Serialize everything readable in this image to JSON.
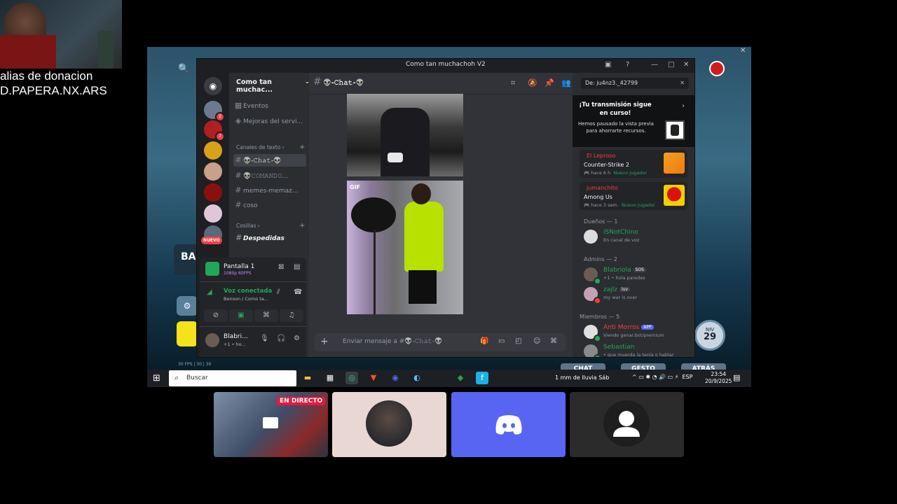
{
  "overlay": {
    "alias_line1": "alias de donacion",
    "alias_line2": "D.PAPERA.NX.ARS"
  },
  "desktop": {
    "ba_label": "BA",
    "niv_label": "NIV",
    "niv_value": "29",
    "fps_text": "30 FPS | 30 | 30",
    "buttons": [
      "CHAT",
      "GESTO",
      "ATRÁS"
    ]
  },
  "window": {
    "title": "Como tan muchachoh V2"
  },
  "servers": {
    "nuevo_label": "NUEVO",
    "badges": [
      "2",
      "2"
    ]
  },
  "channels": {
    "server_name": "Como tan muchac...",
    "top_items": [
      "Eventos",
      "Mejoras del servi..."
    ],
    "category_text": "Canales de texto",
    "items": [
      "👽-𝙲𝚑𝚊𝚝-👽",
      "👽𝙲𝙾𝙼𝙰𝙽𝙳𝙾...",
      "memes-memaz...",
      "coso"
    ],
    "category_cosillas": "Cosillas",
    "despedidas": "Despedidas"
  },
  "voice": {
    "screen_name": "Pantalla 1",
    "screen_quality": "1080p 60FPS",
    "status": "Voz conectada",
    "location": "Benson / Como ta...",
    "user_name": "Blabri...",
    "user_status": "+1 • ho..."
  },
  "chat": {
    "channel_name": "👽-𝙲𝚑𝚊𝚝-👽",
    "gif_label": "GIF",
    "input_placeholder": "Enviar mensaje a #👽-𝙲𝚑𝚊𝚝-👽"
  },
  "rightpanel": {
    "search_value": "De: ju4nz3._42799",
    "popup_title": "¡Tu transmisión sigue en curso!",
    "popup_desc": "Hemos pausado la vista previa para ahorrarte recursos.",
    "activities": [
      {
        "name": "El Leproso",
        "game": "Counter-Strike 2",
        "time": "hace 6 h",
        "extra": "Nuevo jugador"
      },
      {
        "name": "jumanchito",
        "game": "Among Us",
        "time": "hace 3 sem.",
        "extra": "Nuevo jugador"
      }
    ],
    "owners_header": "Dueños — 1",
    "owner": {
      "name": "iSNotChino",
      "status": "En canal de voz"
    },
    "admins_header": "Admins — 2",
    "admins": [
      {
        "name": "Blabriola",
        "tag": "SOS",
        "status": "+1 • hola paredes"
      },
      {
        "name": "zajlz",
        "tag": "luv",
        "status": "my war is over"
      }
    ],
    "members_header": "Miembros — 5",
    "members": [
      {
        "name": "Anti Morros",
        "tag": "APP",
        "status": "Viendo genai.bot/premium"
      },
      {
        "name": "Sebastian",
        "status": "• que muerda la tenía o hablar"
      }
    ]
  },
  "taskbar": {
    "search_placeholder": "Buscar",
    "weather": "1 mm de lluvia Sáb",
    "lang": "ESP",
    "time": "23:54",
    "date": "20/9/2025"
  },
  "tiles": {
    "live_label": "EN DIRECTO"
  },
  "colors": {
    "discord_blurple": "#5865f2",
    "online_green": "#23a55a",
    "danger_red": "#f23f43",
    "live_red": "#e8173e"
  }
}
